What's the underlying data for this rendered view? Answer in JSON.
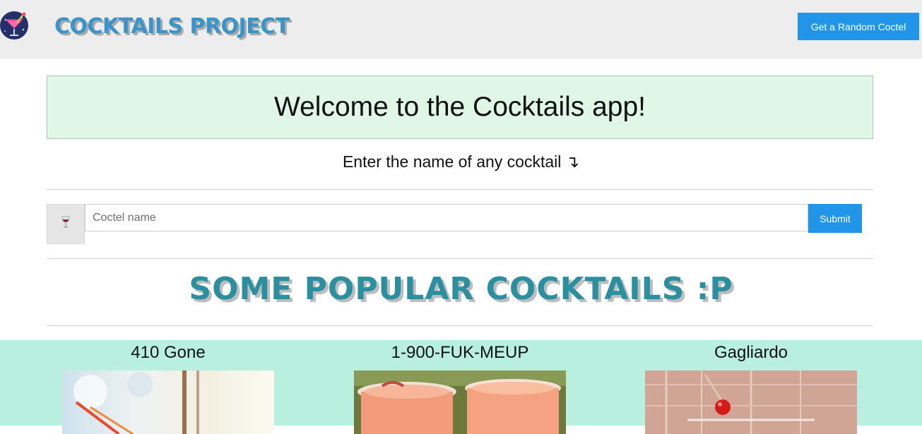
{
  "header": {
    "logo_icon": "cocktail-logo-icon",
    "brand_title": "COCKTAILS PROJECT",
    "random_button_label": "Get a Random Coctel"
  },
  "welcome": {
    "heading": "Welcome to the Cocktails app!",
    "subtitle": "Enter the name of any cocktail ↴"
  },
  "search": {
    "addon_icon": "wine-glass-icon",
    "input_value": "",
    "placeholder": "Coctel name",
    "submit_label": "Submit"
  },
  "popular": {
    "heading": "SOME POPULAR COCKTAILS :P",
    "cards": [
      {
        "name": "410 Gone"
      },
      {
        "name": "1-900-FUK-MEUP"
      },
      {
        "name": "Gagliardo"
      }
    ]
  },
  "colors": {
    "accent_blue": "#2196e8",
    "brand_blue": "#3a93c9",
    "welcome_bg": "#e0f7e8",
    "cards_bg": "#b9efdf",
    "popular_teal": "#2c8fa0"
  }
}
